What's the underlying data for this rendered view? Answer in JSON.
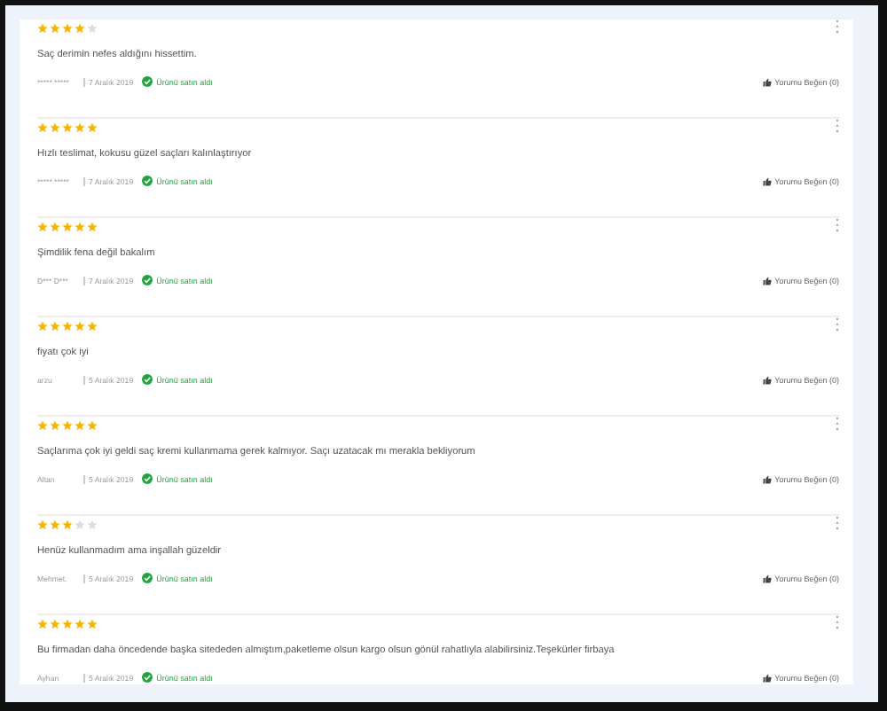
{
  "reviews": [
    {
      "stars": 4,
      "text": "Saç derimin nefes aldığını hissettim.",
      "author": "***** *****",
      "date": "7 Aralık 2019",
      "verified": "Ürünü satın aldı",
      "like": "Yorumu Beğen (0)"
    },
    {
      "stars": 5,
      "text": "Hızlı teslimat, kokusu güzel saçları kalınlaştırıyor",
      "author": "***** *****",
      "date": "7 Aralık 2019",
      "verified": "Ürünü satın aldı",
      "like": "Yorumu Beğen (0)"
    },
    {
      "stars": 5,
      "text": "Şimdilik fena değil bakalım",
      "author": "D*** D***",
      "date": "7 Aralık 2019",
      "verified": "Ürünü satın aldı",
      "like": "Yorumu Beğen (0)"
    },
    {
      "stars": 5,
      "text": "fiyatı çok iyi",
      "author": "arzu",
      "date": "5 Aralık 2019",
      "verified": "Ürünü satın aldı",
      "like": "Yorumu Beğen (0)"
    },
    {
      "stars": 5,
      "text": "Saçlarıma çok iyi geldi saç kremi kullanmama gerek kalmıyor. Saçı uzatacak mı merakla bekliyorum",
      "author": "Altan",
      "date": "5 Aralık 2019",
      "verified": "Ürünü satın aldı",
      "like": "Yorumu Beğen (0)"
    },
    {
      "stars": 3,
      "text": "Henüz kullanmadım ama inşallah güzeldir",
      "author": "Mehmet.",
      "date": "5 Aralık 2019",
      "verified": "Ürünü satın aldı",
      "like": "Yorumu Beğen (0)"
    },
    {
      "stars": 5,
      "text": "Bu firmadan daha öncedende başka sitededen almıştım,paketleme olsun kargo olsun gönül rahatlıyla alabilirsiniz.Teşekürler firbaya",
      "author": "Ayhan",
      "date": "5 Aralık 2019",
      "verified": "Ürünü satın aldı",
      "like": "Yorumu Beğen (0)"
    }
  ]
}
